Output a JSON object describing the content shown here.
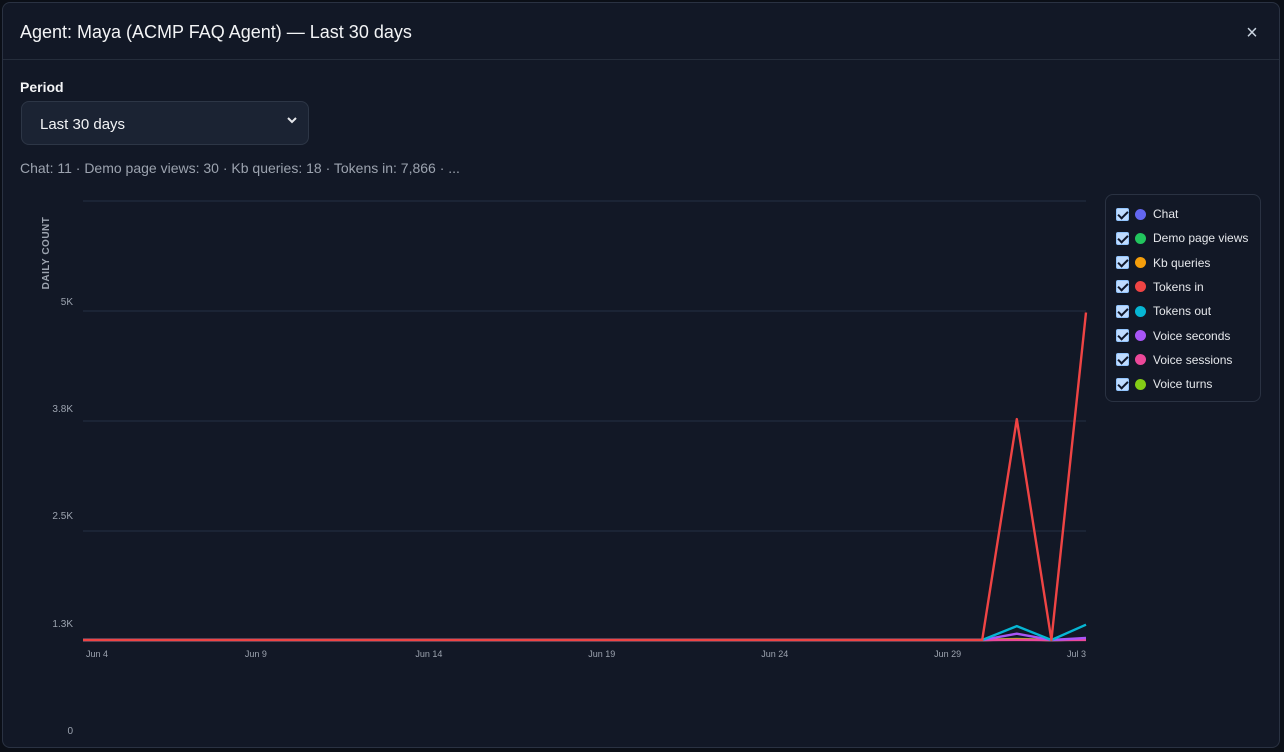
{
  "modal": {
    "title": "Agent: Maya (ACMP FAQ Agent) — Last 30 days",
    "close_label": "×"
  },
  "period": {
    "label": "Period",
    "selected": "Last 30 days"
  },
  "summary": "Chat: 11 · Demo page views: 30 · Kb queries: 18 · Tokens in: 7,866 · ...",
  "legend": [
    {
      "label": "Chat",
      "color": "#6366f1",
      "checked": true
    },
    {
      "label": "Demo page views",
      "color": "#22c55e",
      "checked": true
    },
    {
      "label": "Kb queries",
      "color": "#f59e0b",
      "checked": true
    },
    {
      "label": "Tokens in",
      "color": "#ef4444",
      "checked": true
    },
    {
      "label": "Tokens out",
      "color": "#06b6d4",
      "checked": true
    },
    {
      "label": "Voice seconds",
      "color": "#a855f7",
      "checked": true
    },
    {
      "label": "Voice sessions",
      "color": "#ec4899",
      "checked": true
    },
    {
      "label": "Voice turns",
      "color": "#84cc16",
      "checked": true
    }
  ],
  "chart_data": {
    "type": "line",
    "ylabel": "DAILY COUNT",
    "y_ticks": [
      "0",
      "1.3K",
      "2.5K",
      "3.8K",
      "5K"
    ],
    "ylim": [
      0,
      6300
    ],
    "x_tick_labels": [
      "Jun 4",
      "Jun 9",
      "Jun 14",
      "Jun 19",
      "Jun 24",
      "Jun 29",
      "Jul 3"
    ],
    "x": [
      "Jun 4",
      "Jun 5",
      "Jun 6",
      "Jun 7",
      "Jun 8",
      "Jun 9",
      "Jun 10",
      "Jun 11",
      "Jun 12",
      "Jun 13",
      "Jun 14",
      "Jun 15",
      "Jun 16",
      "Jun 17",
      "Jun 18",
      "Jun 19",
      "Jun 20",
      "Jun 21",
      "Jun 22",
      "Jun 23",
      "Jun 24",
      "Jun 25",
      "Jun 26",
      "Jun 27",
      "Jun 28",
      "Jun 29",
      "Jun 30",
      "Jul 1",
      "Jul 2",
      "Jul 3"
    ],
    "series": [
      {
        "name": "Chat",
        "color": "#6366f1",
        "values": [
          0,
          0,
          0,
          0,
          0,
          0,
          0,
          0,
          0,
          0,
          0,
          0,
          0,
          0,
          0,
          0,
          0,
          0,
          0,
          0,
          0,
          0,
          0,
          0,
          0,
          0,
          0,
          6,
          0,
          5
        ]
      },
      {
        "name": "Demo page views",
        "color": "#22c55e",
        "values": [
          0,
          0,
          0,
          0,
          0,
          0,
          0,
          0,
          0,
          0,
          0,
          0,
          0,
          0,
          0,
          0,
          0,
          0,
          0,
          0,
          0,
          0,
          0,
          0,
          0,
          0,
          0,
          15,
          0,
          15
        ]
      },
      {
        "name": "Kb queries",
        "color": "#f59e0b",
        "values": [
          0,
          0,
          0,
          0,
          0,
          0,
          0,
          0,
          0,
          0,
          0,
          0,
          0,
          0,
          0,
          0,
          0,
          0,
          0,
          0,
          0,
          0,
          0,
          0,
          0,
          0,
          0,
          10,
          0,
          8
        ]
      },
      {
        "name": "Tokens in",
        "color": "#ef4444",
        "values": [
          0,
          0,
          0,
          0,
          0,
          0,
          0,
          0,
          0,
          0,
          0,
          0,
          0,
          0,
          0,
          0,
          0,
          0,
          0,
          0,
          0,
          0,
          0,
          0,
          0,
          0,
          0,
          3170,
          0,
          4700
        ]
      },
      {
        "name": "Tokens out",
        "color": "#06b6d4",
        "values": [
          0,
          0,
          0,
          0,
          0,
          0,
          0,
          0,
          0,
          0,
          0,
          0,
          0,
          0,
          0,
          0,
          0,
          0,
          0,
          0,
          0,
          0,
          0,
          0,
          0,
          0,
          0,
          200,
          0,
          220
        ]
      },
      {
        "name": "Voice seconds",
        "color": "#a855f7",
        "values": [
          0,
          0,
          0,
          0,
          0,
          0,
          0,
          0,
          0,
          0,
          0,
          0,
          0,
          0,
          0,
          0,
          0,
          0,
          0,
          0,
          0,
          0,
          0,
          0,
          0,
          0,
          0,
          90,
          0,
          30
        ]
      },
      {
        "name": "Voice sessions",
        "color": "#ec4899",
        "values": [
          0,
          0,
          0,
          0,
          0,
          0,
          0,
          0,
          0,
          0,
          0,
          0,
          0,
          0,
          0,
          0,
          0,
          0,
          0,
          0,
          0,
          0,
          0,
          0,
          0,
          0,
          0,
          2,
          0,
          1
        ]
      },
      {
        "name": "Voice turns",
        "color": "#84cc16",
        "values": [
          0,
          0,
          0,
          0,
          0,
          0,
          0,
          0,
          0,
          0,
          0,
          0,
          0,
          0,
          0,
          0,
          0,
          0,
          0,
          0,
          0,
          0,
          0,
          0,
          0,
          0,
          0,
          12,
          0,
          9
        ]
      }
    ],
    "grid": true,
    "legend_position": "top-right"
  }
}
